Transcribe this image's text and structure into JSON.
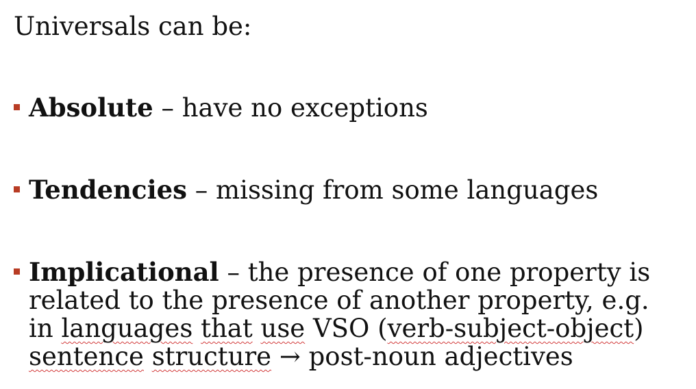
{
  "slide": {
    "title": "Universals can be:",
    "bullet_color": "#b83c24",
    "items": [
      {
        "term": "Absolute",
        "description": " – have no exceptions"
      },
      {
        "term": "Tendencies",
        "description": " – missing from some languages"
      },
      {
        "term": "Implicational",
        "description": " – the presence of one property is",
        "line2": "related to the presence of another property, e.g.",
        "line3": {
          "pre": "in ",
          "w1": "languages",
          "sp1": " ",
          "w2": "that",
          "sp2": " ",
          "w3": "use",
          "mid": " VSO (",
          "w4": "verb-subject-object",
          "post": ")"
        },
        "line4": {
          "w1": "sentence",
          "sp1": " ",
          "w2": "structure",
          "post": " → post-noun adjectives"
        }
      }
    ]
  }
}
